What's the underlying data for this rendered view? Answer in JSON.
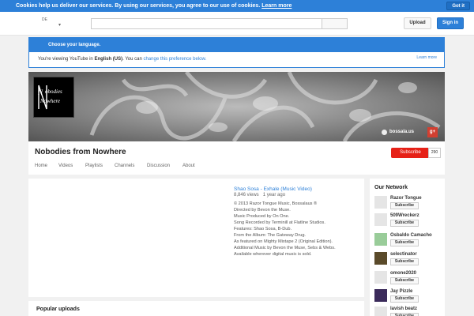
{
  "cookie": {
    "message": "Cookies help us deliver our services. By using our services, you agree to our use of cookies.",
    "learn_more": "Learn more",
    "got_it": "Got it"
  },
  "masthead": {
    "region": "DE",
    "upload": "Upload",
    "sign_in": "Sign in"
  },
  "language": {
    "heading": "Choose your language.",
    "prefix": "You're viewing YouTube in ",
    "language": "English (US)",
    "middle": ". You can ",
    "change_link": "change this preference below.",
    "learn_more": "Learn more"
  },
  "channel": {
    "banner_link": "bossala.us",
    "gplus": "g+",
    "title": "Nobodies from Nowhere",
    "subscribe": "Subscribe",
    "sub_count": "290",
    "tabs": [
      {
        "label": "Home",
        "active": true
      },
      {
        "label": "Videos",
        "active": false
      },
      {
        "label": "Playlists",
        "active": false
      },
      {
        "label": "Channels",
        "active": false
      },
      {
        "label": "Discussion",
        "active": false
      },
      {
        "label": "About",
        "active": false
      }
    ]
  },
  "video": {
    "title": "Shao Sosa - Exhale (Music Video)",
    "views": "8,846 views",
    "age": "1 year ago",
    "description": [
      "© 2013 Razor Tongue Music, Bossalaus ®",
      "Directed by Bevon the Muse.",
      "Music Produced by On One.",
      "Song Recorded by Terminill at Flatline Studios.",
      "Features: Shao Sosa, B-Dub.",
      "From the Album: The Gateway Drug.",
      "As featured on Mighty Mixtape 2 (Original Edition).",
      "Additional Music by Bevon the Muse, Sebs & Webs.",
      "Available wherever digital music is sold."
    ]
  },
  "popular": {
    "title": "Popular uploads"
  },
  "network": {
    "title": "Our Network",
    "subscribe_label": "Subscribe",
    "items": [
      {
        "name": "Razor Tongue"
      },
      {
        "name": "509Wreckerz"
      },
      {
        "name": "Osbaldo Camacho"
      },
      {
        "name": "selectinator"
      },
      {
        "name": "omone2020"
      },
      {
        "name": "Jay Pizzle"
      },
      {
        "name": "lavish beatz"
      }
    ]
  }
}
